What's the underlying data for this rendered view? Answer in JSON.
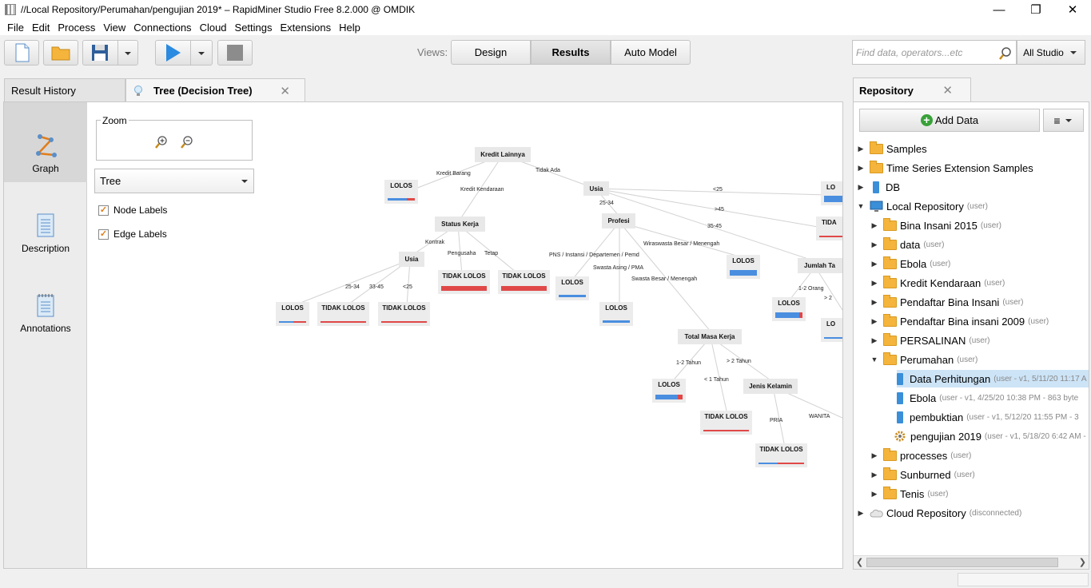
{
  "window": {
    "title": "//Local Repository/Perumahan/pengujian 2019* – RapidMiner Studio Free 8.2.000 @ OMDIK",
    "minimize": "—",
    "restore": "❐",
    "close": "✕"
  },
  "menu": [
    "File",
    "Edit",
    "Process",
    "View",
    "Connections",
    "Cloud",
    "Settings",
    "Extensions",
    "Help"
  ],
  "views": {
    "label": "Views:",
    "design": "Design",
    "results": "Results",
    "auto_model": "Auto Model"
  },
  "search": {
    "placeholder": "Find data, operators...etc",
    "scope": "All Studio"
  },
  "tabs": {
    "result_history": "Result History",
    "tree": "Tree (Decision Tree)"
  },
  "nav": {
    "graph": "Graph",
    "description": "Description",
    "annotations": "Annotations"
  },
  "controls": {
    "zoom": "Zoom",
    "layout": "Tree",
    "node_labels": "Node Labels",
    "edge_labels": "Edge Labels"
  },
  "tree": {
    "nodes": {
      "root": "Kredit Lainnya",
      "usia1": "Usia",
      "status_kerja": "Status Kerja",
      "profesi": "Profesi",
      "usia2": "Usia",
      "total_masa_kerja": "Total Masa Kerja",
      "jenis_kelamin": "Jenis Kelamin",
      "jumlah": "Jumlah Ta"
    },
    "leaves": {
      "l_barang": "LOLOS",
      "l_peng": "TIDAK LOLOS",
      "l_tetap": "TIDAK LOLOS",
      "l_2534": "LOLOS",
      "l_3345": "TIDAK LOLOS",
      "l_lt25": "TIDAK LOLOS",
      "l_pns": "LOLOS",
      "l_swasta": "LOLOS",
      "l_wira": "LOLOS",
      "l_12": "LOLOS",
      "l_lt1": "TIDAK LOLOS",
      "l_wanita": "TIDAK LOLOS",
      "l_top": "LO",
      "l_tida": "TIDA",
      "l_12o": "LOLOS",
      "l_lo2": "LO"
    },
    "edges": {
      "kredit_barang": "Kredit Barang",
      "kredit_kendaraan": "Kredit Kendaraan",
      "tidak_ada": "Tidak Ada",
      "kontrak": "Kontrak",
      "pengusaha": "Pengusaha",
      "tetap": "Tetap",
      "a2534": "25-34",
      "a3345": "33-45",
      "alt25": "<25",
      "b2534": "25-34",
      "blt25": "<25",
      "bgt45": ">45",
      "b3545": "35-45",
      "pns": "PNS / Instansi / Departemen / Pemd",
      "swasta_asing": "Swasta Asing / PMA",
      "swasta_besar": "Swasta Besar / Menengah",
      "wiraswasta": "Wiraswasta Besar / Menengah",
      "t12": "1-2 Tahun",
      "tgt2": "> 2 Tahun",
      "tlt1": "< 1 Tahun",
      "pria": "PRIA",
      "wanita": "WANITA",
      "o12": "1-2 Orang",
      "ogt2": "> 2"
    }
  },
  "repository": {
    "title": "Repository",
    "add_data": "Add Data",
    "items": [
      {
        "label": "Samples",
        "tag": ""
      },
      {
        "label": "Time Series Extension Samples",
        "tag": ""
      },
      {
        "label": "DB",
        "tag": ""
      },
      {
        "label": "Local Repository",
        "tag": "(user)"
      },
      {
        "label": "Bina Insani 2015",
        "tag": "(user)"
      },
      {
        "label": "data",
        "tag": "(user)"
      },
      {
        "label": "Ebola",
        "tag": "(user)"
      },
      {
        "label": "Kredit Kendaraan",
        "tag": "(user)"
      },
      {
        "label": "Pendaftar Bina Insani",
        "tag": "(user)"
      },
      {
        "label": "Pendaftar Bina insani 2009",
        "tag": "(user)"
      },
      {
        "label": "PERSALINAN",
        "tag": "(user)"
      },
      {
        "label": "Perumahan",
        "tag": "(user)"
      },
      {
        "label": "Data Perhitungan",
        "tag": "(user - v1, 5/11/20 11:17 A"
      },
      {
        "label": "Ebola",
        "tag": "(user - v1, 4/25/20 10:38 PM - 863 byte"
      },
      {
        "label": "pembuktian",
        "tag": "(user - v1, 5/12/20 11:55 PM - 3"
      },
      {
        "label": "pengujian 2019",
        "tag": "(user - v1, 5/18/20 6:42 AM -"
      },
      {
        "label": "processes",
        "tag": "(user)"
      },
      {
        "label": "Sunburned",
        "tag": "(user)"
      },
      {
        "label": "Tenis",
        "tag": "(user)"
      },
      {
        "label": "Cloud Repository",
        "tag": "(disconnected)"
      }
    ]
  },
  "colors": {
    "lolos": "#4a8ee0",
    "tidak_lolos": "#e04848",
    "accent_orange": "#e27c1a"
  }
}
